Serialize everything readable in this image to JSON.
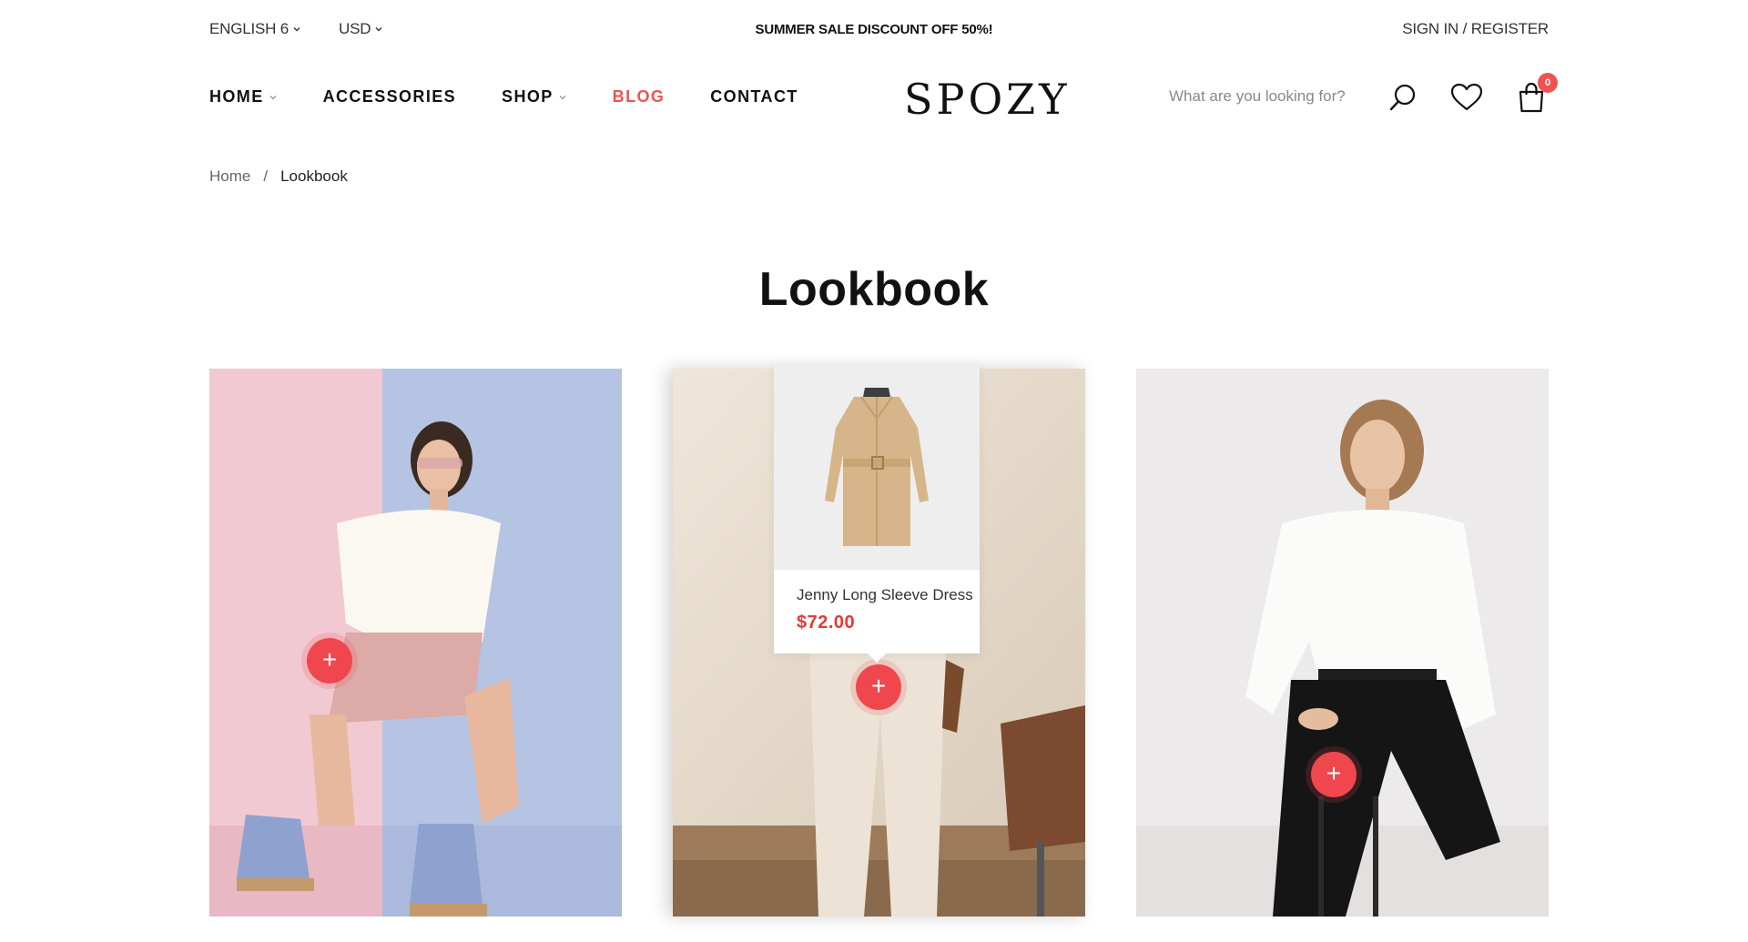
{
  "topbar": {
    "language": "ENGLISH 6",
    "currency": "USD",
    "promo": "SUMMER SALE DISCOUNT OFF 50%!",
    "account": "SIGN IN / REGISTER"
  },
  "nav": {
    "items": [
      {
        "label": "HOME",
        "has_dropdown": true
      },
      {
        "label": "ACCESSORIES",
        "has_dropdown": false
      },
      {
        "label": "SHOP",
        "has_dropdown": true
      },
      {
        "label": "BLOG",
        "has_dropdown": false,
        "active": true
      },
      {
        "label": "CONTACT",
        "has_dropdown": false
      }
    ]
  },
  "logo": "SPOZY",
  "search": {
    "placeholder": "What are you looking for?"
  },
  "icons": {
    "search": "search-icon",
    "wishlist": "heart-icon",
    "cart": "shopping-bag-icon"
  },
  "cart": {
    "count": "0"
  },
  "breadcrumb": {
    "home": "Home",
    "separator": "/",
    "current": "Lookbook"
  },
  "page": {
    "title": "Lookbook"
  },
  "lookbook": {
    "hotspot_symbol": "+",
    "popup": {
      "product_name": "Jenny Long Sleeve Dress",
      "price": "$72.00"
    }
  },
  "colors": {
    "accent": "#ef5350",
    "price": "#e53935",
    "hotspot": "#f0474f"
  }
}
